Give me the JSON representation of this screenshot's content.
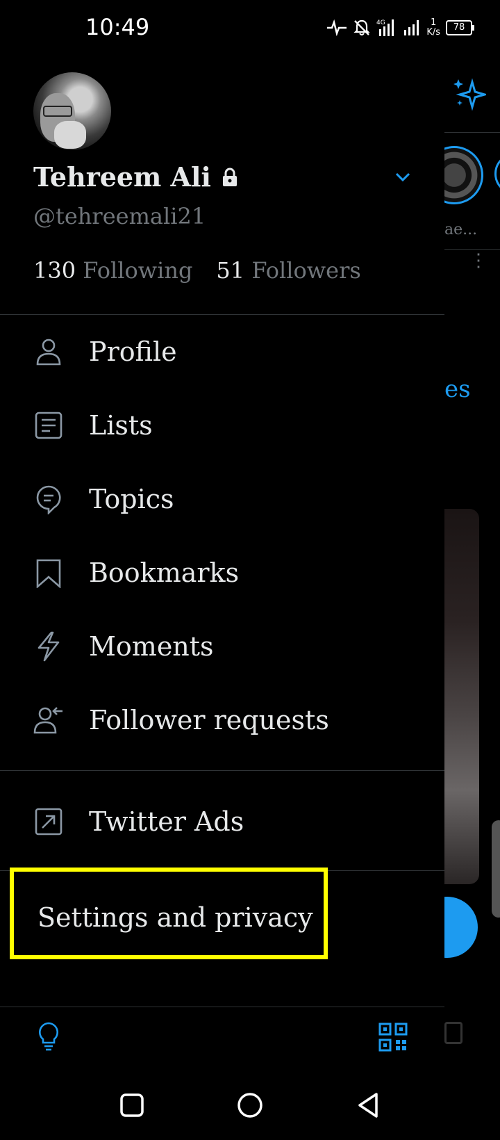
{
  "status_bar": {
    "time": "10:49",
    "network": "4G",
    "speed_value": "1",
    "speed_unit": "K/s",
    "battery": "78"
  },
  "profile": {
    "name": "Tehreem Ali",
    "handle": "@tehreemali21",
    "following_count": "130",
    "following_label": "Following",
    "followers_count": "51",
    "followers_label": "Followers"
  },
  "menu": [
    {
      "label": "Profile",
      "icon": "person-icon"
    },
    {
      "label": "Lists",
      "icon": "list-icon"
    },
    {
      "label": "Topics",
      "icon": "topics-icon"
    },
    {
      "label": "Bookmarks",
      "icon": "bookmark-icon"
    },
    {
      "label": "Moments",
      "icon": "lightning-icon"
    },
    {
      "label": "Follower requests",
      "icon": "follower-requests-icon"
    }
  ],
  "ads": {
    "label": "Twitter Ads",
    "icon": "external-link-icon"
  },
  "settings": {
    "label": "Settings and privacy"
  },
  "background": {
    "fleet_name": "ae...",
    "tab_fragment": "es"
  },
  "colors": {
    "accent": "#1d9bf0",
    "highlight": "#ffff00",
    "text": "#e7e9ea",
    "muted": "#71767b",
    "divider": "#2f3336"
  }
}
